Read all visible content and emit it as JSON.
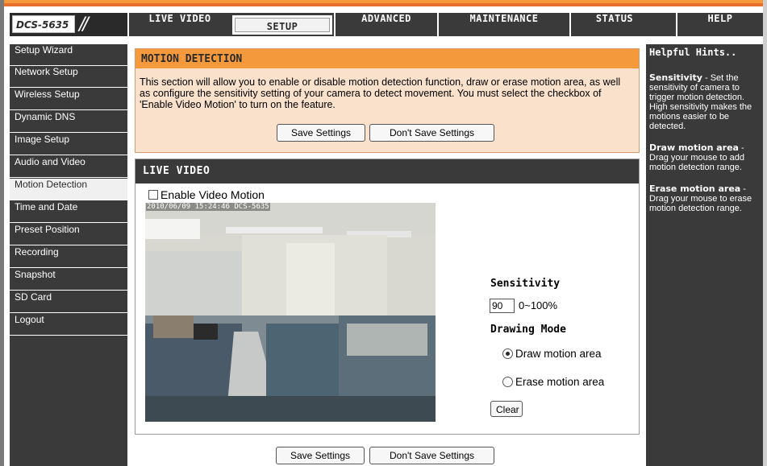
{
  "product": {
    "model": "DCS-5635"
  },
  "nav": {
    "tabs": [
      {
        "label": "LIVE VIDEO"
      },
      {
        "label": "SETUP"
      },
      {
        "label": "ADVANCED"
      },
      {
        "label": "MAINTENANCE"
      },
      {
        "label": "STATUS"
      },
      {
        "label": "HELP"
      }
    ],
    "active_tab": "SETUP"
  },
  "sidebar": {
    "items": [
      {
        "label": "Setup Wizard"
      },
      {
        "label": "Network Setup"
      },
      {
        "label": "Wireless Setup"
      },
      {
        "label": "Dynamic DNS"
      },
      {
        "label": "Image Setup"
      },
      {
        "label": "Audio and Video"
      },
      {
        "label": "Motion Detection"
      },
      {
        "label": "Time and Date"
      },
      {
        "label": "Preset Position"
      },
      {
        "label": "Recording"
      },
      {
        "label": "Snapshot"
      },
      {
        "label": "SD Card"
      },
      {
        "label": "Logout"
      }
    ],
    "active_item": "Motion Detection"
  },
  "motion": {
    "title": "MOTION DETECTION",
    "description": "This section will allow you to enable or disable motion detection function, draw or erase motion area, as well as configure the sensitivity setting of your camera to detect movement. You must select the checkbox of 'Enable Video Motion' to turn on the feature.",
    "save_label": "Save Settings",
    "dont_save_label": "Don't Save Settings"
  },
  "live": {
    "title": "LIVE VIDEO",
    "enable_label": "Enable Video Motion",
    "enable_checked": false,
    "timestamp": "2010/06/09 15:24:46 DCS-5635",
    "sensitivity_label": "Sensitivity",
    "sensitivity_value": "90",
    "sensitivity_range": "0~100%",
    "drawing_mode_label": "Drawing Mode",
    "draw_option": "Draw motion area",
    "erase_option": "Erase motion area",
    "selected_mode": "draw",
    "clear_label": "Clear"
  },
  "footer": {
    "save_label": "Save Settings",
    "dont_save_label": "Don't Save Settings"
  },
  "hints": {
    "title": "Helpful Hints..",
    "items": [
      {
        "head": "Sensitivity",
        "sep": " - ",
        "body": "Set the sensitivity of camera to trigger motion detection. High sensitivity makes the motions easier to be detected."
      },
      {
        "head": "Draw motion area",
        "sep": " - ",
        "body": "Drag your mouse to add motion detection range."
      },
      {
        "head": "Erase motion area",
        "sep": " - ",
        "body": "Drag your mouse to erase motion detection range."
      }
    ]
  },
  "colors": {
    "accent_orange": "#f59a3c",
    "dark_gray": "#3a3a3a",
    "panel_peach": "#f9e1cc"
  }
}
